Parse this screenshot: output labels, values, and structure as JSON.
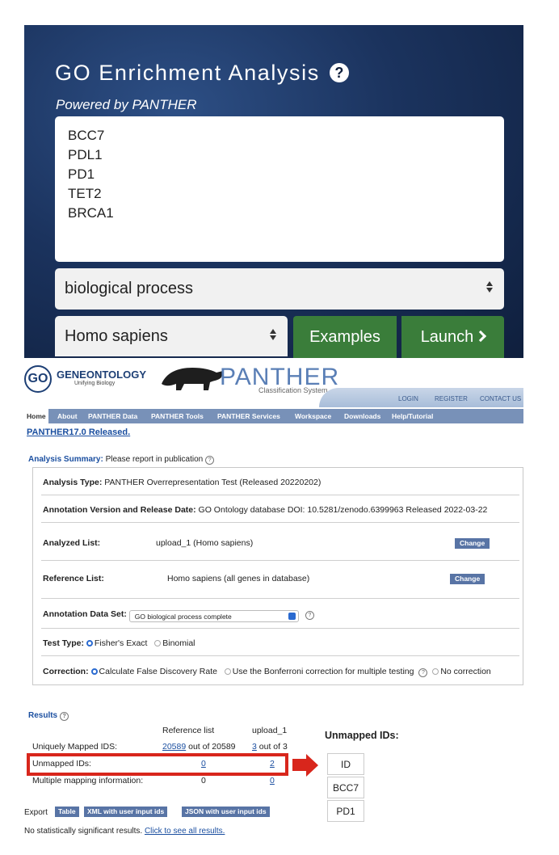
{
  "hero": {
    "title": "GO Enrichment Analysis",
    "subtitle": "Powered by PANTHER",
    "genes": [
      "BCC7",
      "PDL1",
      "PD1",
      "TET2",
      "BRCA1"
    ],
    "aspect_select": "biological process",
    "organism_select": "Homo sapiens",
    "examples_label": "Examples",
    "launch_label": "Launch"
  },
  "header": {
    "go_logo_name": "GENEONTOLOGY",
    "go_logo_tag": "Unifying Biology",
    "panther_name": "PANTHER",
    "panther_tag": "Classification System",
    "top_links": [
      "LOGIN",
      "REGISTER",
      "CONTACT US"
    ],
    "nav": [
      "Home",
      "About",
      "PANTHER Data",
      "PANTHER Tools",
      "PANTHER Services",
      "Workspace",
      "Downloads",
      "Help/Tutorial"
    ],
    "release": "PANTHER17.0 Released."
  },
  "summary": {
    "title_label": "Analysis Summary:",
    "title_rest": " Please report in publication",
    "analysis_type_label": "Analysis Type:",
    "analysis_type_value": " PANTHER Overrepresentation Test (Released 20220202)",
    "annotation_label": "Annotation Version and Release Date:",
    "annotation_value": " GO Ontology database DOI: 10.5281/zenodo.6399963 Released 2022-03-22",
    "analyzed_label": "Analyzed List:",
    "analyzed_value": "upload_1 (Homo sapiens)",
    "reference_label": "Reference List:",
    "reference_value": "Homo sapiens (all genes in database)",
    "change_label": "Change",
    "dataset_label": "Annotation Data Set:",
    "dataset_value": "GO biological process complete",
    "test_label": "Test Type:",
    "test_fisher": "Fisher's Exact",
    "test_binomial": "Binomial",
    "correction_label": "Correction:",
    "correction_fdr": "Calculate False Discovery Rate",
    "correction_bonferroni": "Use the Bonferroni correction for multiple testing",
    "correction_none": "No correction"
  },
  "results": {
    "title": "Results",
    "col_reference": "Reference list",
    "col_upload": "upload_1",
    "rows": {
      "uniquely_label": "Uniquely Mapped IDS:",
      "uniquely_ref_count": "20589",
      "uniquely_ref_rest": " out of 20589",
      "uniquely_up_count": "3",
      "uniquely_up_rest": " out of 3",
      "unmapped_label": "Unmapped IDs:",
      "unmapped_ref": "0",
      "unmapped_up": "2",
      "multiple_label": "Multiple mapping information:",
      "multiple_ref": "0",
      "multiple_up": "0"
    },
    "export_label": "Export",
    "export_buttons": [
      "Table",
      "XML with user input ids",
      "JSON with user input ids"
    ],
    "no_sig_text": "No statistically significant results. ",
    "no_sig_link": "Click to see all results."
  },
  "unmapped": {
    "title": "Unmapped IDs:",
    "header": "ID",
    "ids": [
      "BCC7",
      "PD1"
    ]
  },
  "colors": {
    "hero_bg": "#1b335e",
    "button_green": "#3a7d3a",
    "nav_blue": "#7891b8",
    "highlight_red": "#d8261c"
  }
}
